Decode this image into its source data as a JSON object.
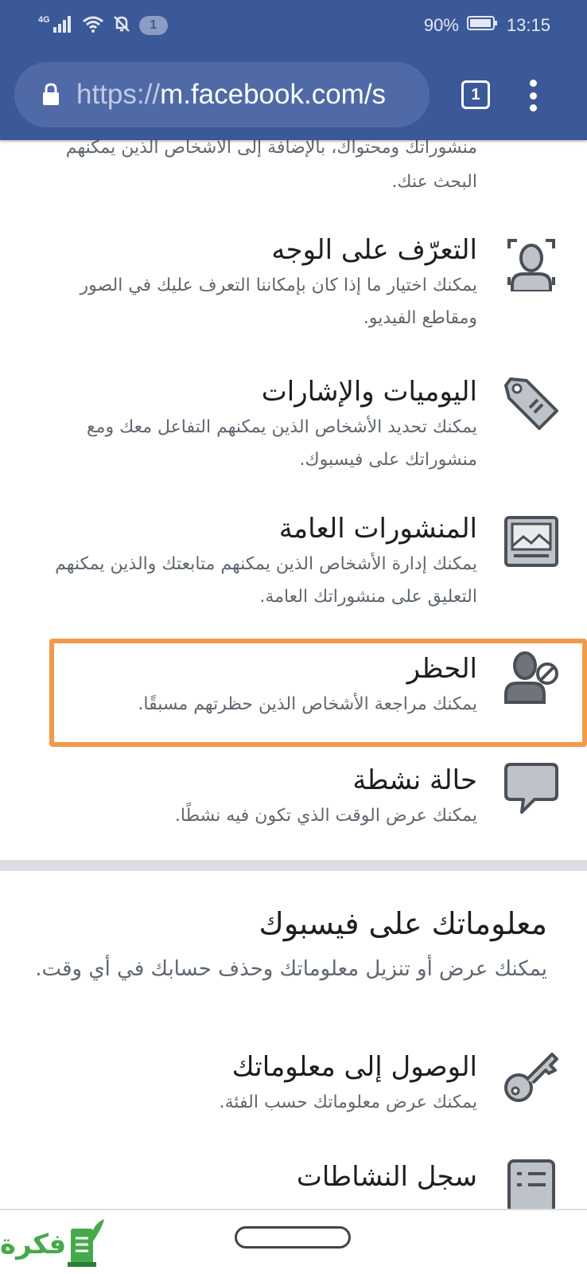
{
  "status_bar": {
    "network": "4G",
    "notification_count": "1",
    "battery": "90%",
    "time": "13:15"
  },
  "browser": {
    "url_scheme": "https://",
    "url_rest": "m.facebook.com/s",
    "tab_count": "1"
  },
  "intro_text": "منشوراتك ومحتواك، بالإضافة إلى الأشخاص الذين يمكنهم البحث عنك.",
  "items": [
    {
      "title": "التعرّف على الوجه",
      "desc": "يمكنك اختيار ما إذا كان بإمكاننا التعرف عليك في الصور ومقاطع الفيديو.",
      "icon": "face-recognition-icon"
    },
    {
      "title": "اليوميات والإشارات",
      "desc": "يمكنك تحديد الأشخاص الذين يمكنهم التفاعل معك ومع منشوراتك على فيسبوك.",
      "icon": "tag-icon"
    },
    {
      "title": "المنشورات العامة",
      "desc": "يمكنك إدارة الأشخاص الذين يمكنهم متابعتك والذين يمكنهم التعليق على منشوراتك العامة.",
      "icon": "public-posts-icon"
    },
    {
      "title": "الحظر",
      "desc": "يمكنك مراجعة الأشخاص الذين حظرتهم مسبقًا.",
      "icon": "block-user-icon"
    },
    {
      "title": "حالة نشطة",
      "desc": "يمكنك عرض الوقت الذي تكون فيه نشطًا.",
      "icon": "chat-bubble-icon"
    }
  ],
  "section": {
    "title": "معلوماتك على فيسبوك",
    "desc": "يمكنك عرض أو تنزيل معلوماتك وحذف حسابك في أي وقت."
  },
  "section_items": [
    {
      "title": "الوصول إلى معلوماتك",
      "desc": "يمكنك عرض معلوماتك حسب الفئة.",
      "icon": "key-icon"
    },
    {
      "title": "سجل النشاطات",
      "icon": "activity-log-icon"
    }
  ],
  "watermark": "فكرة",
  "colors": {
    "brand": "#3b5998",
    "highlight": "#f29a4b",
    "icon_fill": "#bec3c9",
    "icon_stroke": "#4b4f56"
  }
}
